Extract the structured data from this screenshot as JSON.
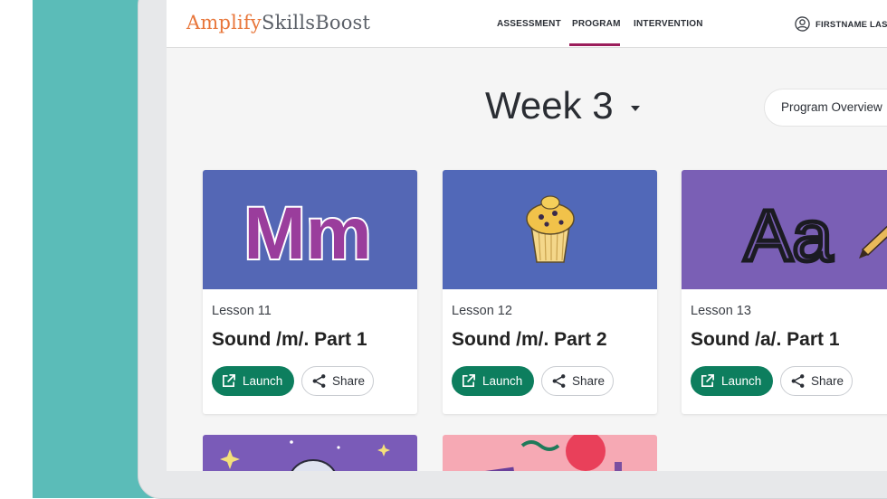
{
  "app": {
    "logo_part1": "Amplify",
    "logo_part2": "SkillsBoost"
  },
  "nav": {
    "items": [
      {
        "label": "ASSESSMENT"
      },
      {
        "label": "PROGRAM"
      },
      {
        "label": "INTERVENTION"
      }
    ],
    "active": "PROGRAM",
    "user_name": "FIRSTNAME LAST"
  },
  "header": {
    "week_label": "Week 3",
    "overview_label": "Program Overview"
  },
  "cards": [
    {
      "lesson": "Lesson 11",
      "title": "Sound /m/. Part 1",
      "art": "letters Mm",
      "launch": "Launch",
      "share": "Share"
    },
    {
      "lesson": "Lesson 12",
      "title": "Sound /m/. Part 2",
      "art": "muffin",
      "launch": "Launch",
      "share": "Share"
    },
    {
      "lesson": "Lesson 13",
      "title": "Sound /a/. Part 1",
      "art": "letters Aa with pencil",
      "launch": "Launch",
      "share": "Share"
    }
  ],
  "art_text": {
    "card0": "Mm",
    "card2": "Aa"
  },
  "icons": {
    "launch": "external-link-icon",
    "share": "share-icon",
    "user": "user-circle-icon",
    "caret": "caret-down-icon"
  },
  "colors": {
    "accent_green": "#0d7e5e",
    "nav_active": "#9b1d5b",
    "logo_orange": "#e8763a",
    "teal_background": "#5bbcb8"
  }
}
